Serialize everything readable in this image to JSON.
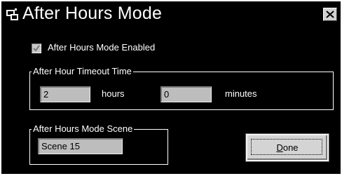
{
  "window": {
    "title": "After Hours Mode",
    "icon": "app-icon",
    "close_icon": "close-icon"
  },
  "enabled_checkbox": {
    "label": "After Hours Mode Enabled",
    "checked": true,
    "disabled": true
  },
  "timeout_group": {
    "legend": "After Hour Timeout Time",
    "hours_value": "2",
    "hours_label": "hours",
    "minutes_value": "0",
    "minutes_label": "minutes"
  },
  "scene_group": {
    "legend": "After Hours Mode Scene",
    "scene_value": "Scene 15"
  },
  "done_button": {
    "mnemonic": "D",
    "rest": "one"
  }
}
